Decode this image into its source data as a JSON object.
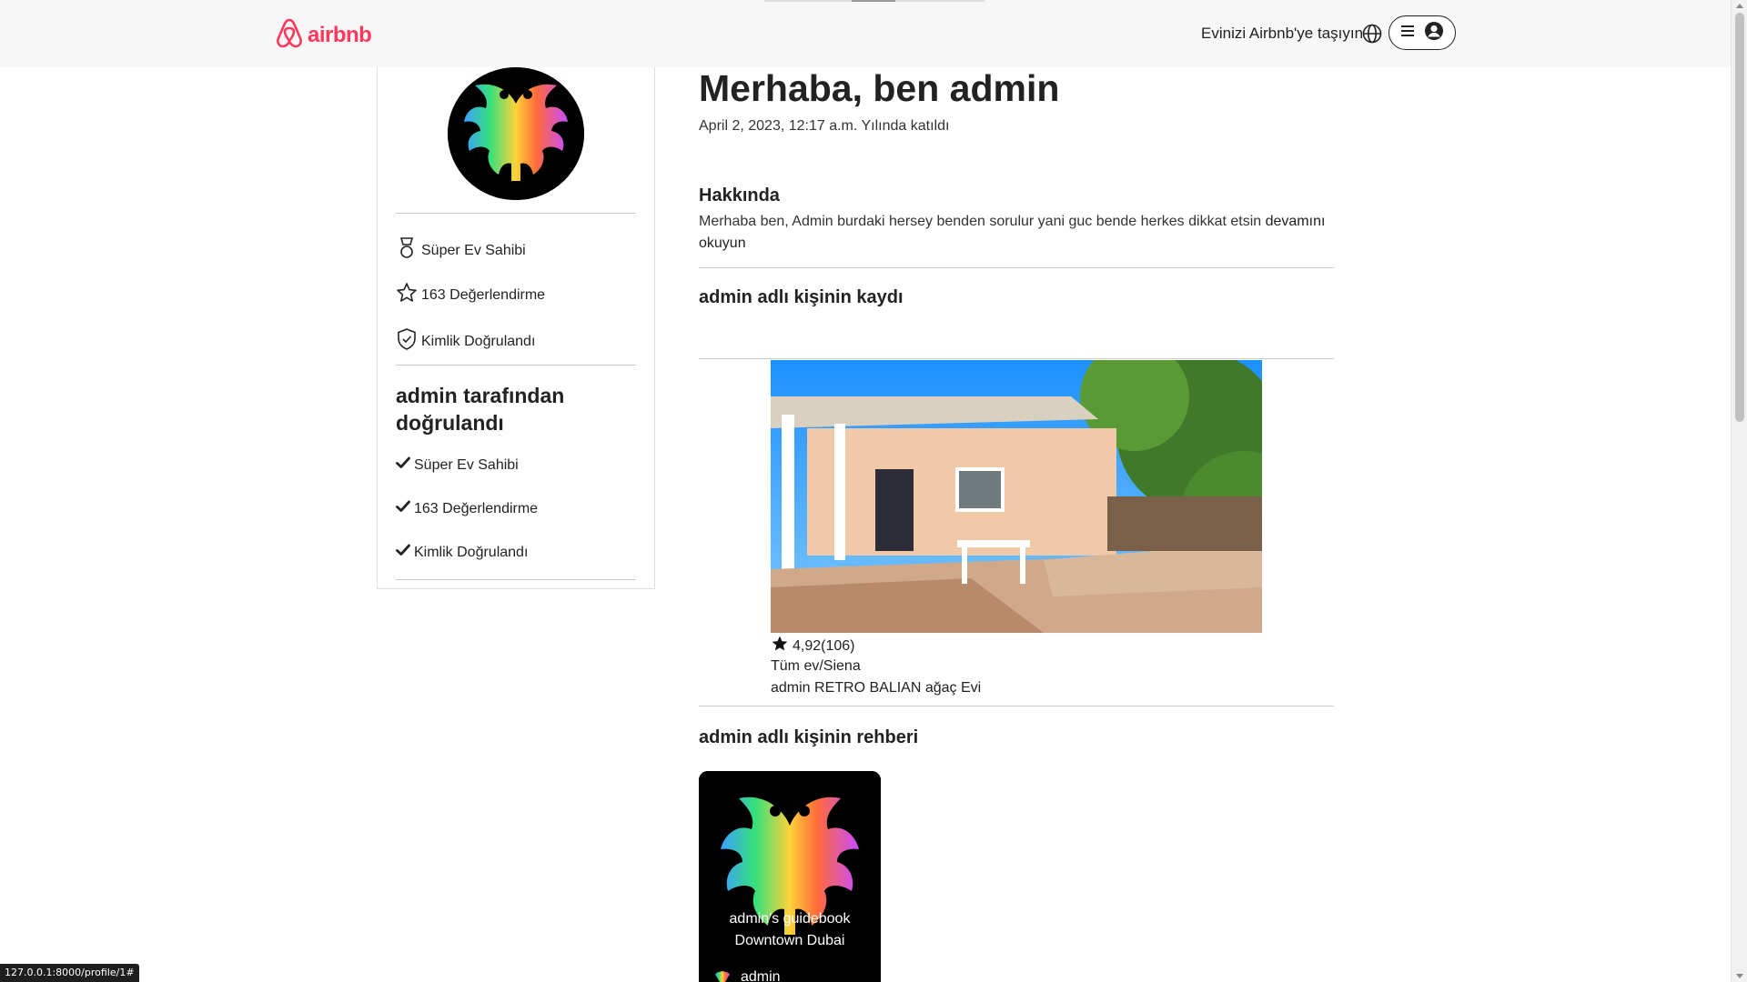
{
  "header": {
    "logo_text": "airbnb",
    "brand_color": "#ff385c",
    "host_link": "Evinizi Airbnb'ye taşıyın",
    "icons": [
      "airbnb-logo-icon",
      "globe-icon",
      "menu-icon",
      "user-circle-icon"
    ]
  },
  "sidebar": {
    "stats": [
      {
        "icon": "medal-icon",
        "label": "Süper Ev Sahibi"
      },
      {
        "icon": "star-icon",
        "label": "163 Değerlendirme"
      },
      {
        "icon": "shield-check-icon",
        "label": "Kimlik Doğrulandı"
      }
    ],
    "verified_title": "admin tarafından doğrulandı",
    "verified_items": [
      "Süper Ev Sahibi",
      "163 Değerlendirme",
      "Kimlik Doğrulandı"
    ]
  },
  "profile": {
    "greeting": "Merhaba, ben admin",
    "joined": "April 2, 2023, 12:17 a.m. Yılında katıldı",
    "about_title": "Hakkında",
    "about_text": "Merhaba ben, Admin burdaki hersey benden sorulur yani guc bende herkes dikkat etsin",
    "about_more": "devamını okuyun"
  },
  "listings": {
    "title": "admin adlı kişinin kaydı",
    "items": [
      {
        "rating": "4,92(106)",
        "type": "Tüm ev/Siena",
        "name": "admin RETRO BALIAN ağaç Evi"
      }
    ]
  },
  "guides": {
    "title": "admin adlı kişinin rehberi",
    "items": [
      {
        "line1": "admin's guidebook",
        "line2": "Downtown Dubai",
        "author": "admin"
      }
    ]
  },
  "status_bar": {
    "url": "127.0.0.1:8000/profile/1#"
  }
}
